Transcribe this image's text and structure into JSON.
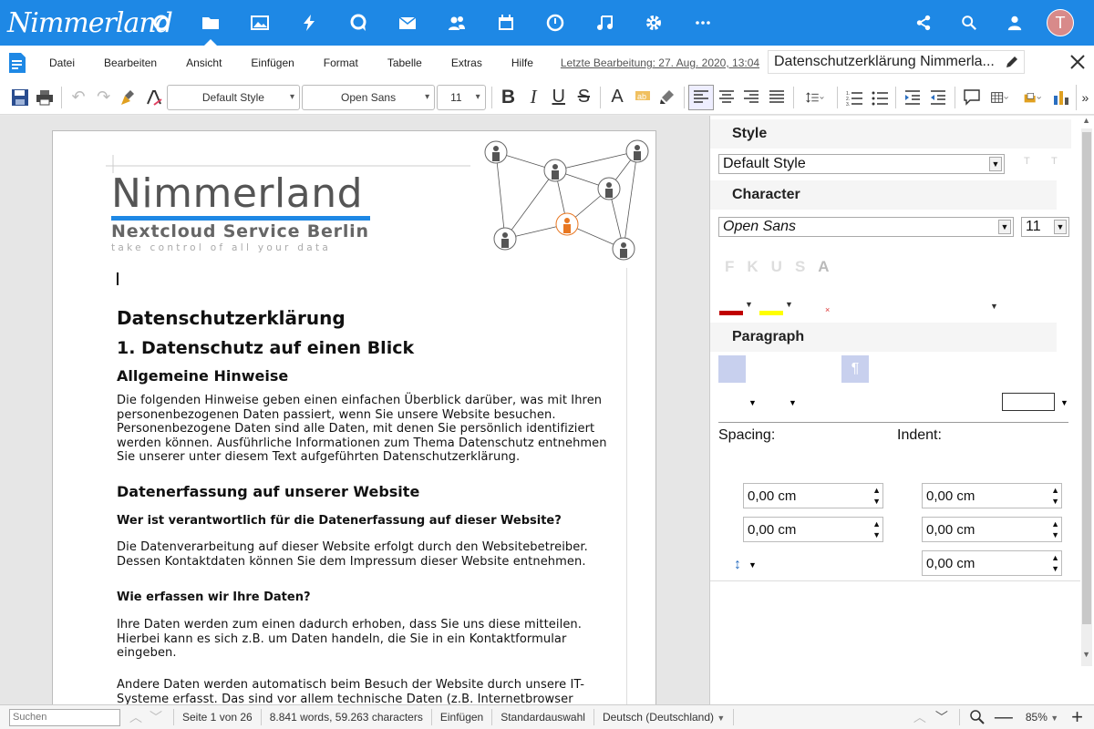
{
  "app": {
    "logo_text": "Nimmerland",
    "icons": [
      "dashboard-icon",
      "files-icon",
      "photos-icon",
      "activity-icon",
      "talk-icon",
      "mail-icon",
      "contacts-icon",
      "calendar-icon",
      "deck-icon",
      "music-icon",
      "settings-icon",
      "more-apps-icon"
    ],
    "avatar_letter": "T",
    "accent": "#1e88e5"
  },
  "menu": {
    "items": [
      "Datei",
      "Bearbeiten",
      "Ansicht",
      "Einfügen",
      "Format",
      "Tabelle",
      "Extras",
      "Hilfe"
    ],
    "last_edit": "Letzte Bearbeitung: 27. Aug. 2020, 13:04",
    "doc_title": "Datenschutzerklärung Nimmerla..."
  },
  "toolbar": {
    "paragraph_style": "Default Style",
    "font_name": "Open Sans",
    "font_size": "11"
  },
  "document": {
    "header_logo_title": "Nimmerland",
    "header_logo_sub": "Nextcloud Service Berlin",
    "header_logo_tag": "take control of all your data",
    "h1": "Datenschutzerklärung",
    "h2": "1. Datenschutz auf einen Blick",
    "h3a": "Allgemeine Hinweise",
    "p1": [
      "Die folgenden Hinweise geben einen einfachen Überblick darüber, was mit Ihren",
      "personenbezogenen Daten passiert, wenn Sie unsere Website besuchen.",
      "Personenbezogene Daten sind alle Daten, mit denen Sie persönlich identifiziert",
      "werden können. Ausführliche Informationen zum Thema Datenschutz entnehmen",
      "Sie unserer unter diesem Text aufgeführten Datenschutzerklärung."
    ],
    "h3b": "Datenerfassung auf unserer Website",
    "h4a": "Wer ist verantwortlich für die Datenerfassung auf dieser Website?",
    "p2": [
      "Die Datenverarbeitung auf dieser Website erfolgt durch den Websitebetreiber.",
      "Dessen Kontaktdaten können Sie dem Impressum dieser Website entnehmen."
    ],
    "h4b": "Wie erfassen wir Ihre Daten?",
    "p3": [
      "Ihre Daten werden zum einen dadurch erhoben, dass Sie uns diese mitteilen.",
      "Hierbei kann es sich z.B. um Daten handeln, die Sie in ein Kontaktformular",
      "eingeben."
    ],
    "p4": [
      "Andere Daten werden automatisch beim Besuch der Website durch unsere IT-",
      "Systeme erfasst. Das sind vor allem technische Daten (z.B. Internetbrowser"
    ]
  },
  "sidebar": {
    "style_title": "Style",
    "style_value": "Default Style",
    "character_title": "Character",
    "char_font": "Open Sans",
    "char_size": "11",
    "paragraph_title": "Paragraph",
    "spacing_label": "Spacing:",
    "indent_label": "Indent:",
    "spacing_above": "0,00 cm",
    "spacing_below": "0,00 cm",
    "indent_before": "0,00 cm",
    "indent_after": "0,00 cm",
    "indent_first": "0,00 cm",
    "font_color": "#c00000",
    "highlight_color": "#ffff00"
  },
  "status": {
    "search_placeholder": "Suchen",
    "page": "Seite 1 von 26",
    "words": "8.841 words, 59.263 characters",
    "mode": "Einfügen",
    "selection": "Standardauswahl",
    "language": "Deutsch (Deutschland)",
    "zoom": "85%"
  }
}
